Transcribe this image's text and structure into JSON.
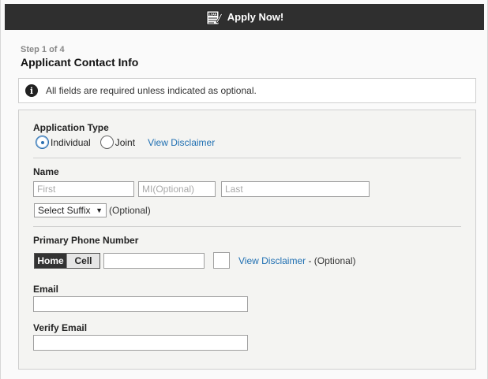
{
  "header": {
    "title": "Apply Now!",
    "icon": "loan-application-icon",
    "icon_text": "LOAN"
  },
  "step": {
    "text": "Step 1 of 4",
    "title": "Applicant Contact Info"
  },
  "notice": {
    "icon": "info-icon",
    "message": "All fields are required unless indicated as optional."
  },
  "application_type": {
    "label": "Application Type",
    "options": [
      {
        "label": "Individual",
        "selected": true
      },
      {
        "label": "Joint",
        "selected": false
      }
    ],
    "disclaimer_link": "View Disclaimer"
  },
  "name": {
    "label": "Name",
    "first_placeholder": "First",
    "mi_placeholder": "MI(Optional)",
    "last_placeholder": "Last",
    "suffix_selected": "Select Suffix",
    "suffix_optional": "(Optional)"
  },
  "phone": {
    "label": "Primary Phone Number",
    "home_label": "Home",
    "cell_label": "Cell",
    "disclaimer_link": "View Disclaimer",
    "optional_text": " - (Optional)"
  },
  "email": {
    "label": "Email"
  },
  "verify_email": {
    "label": "Verify Email"
  }
}
